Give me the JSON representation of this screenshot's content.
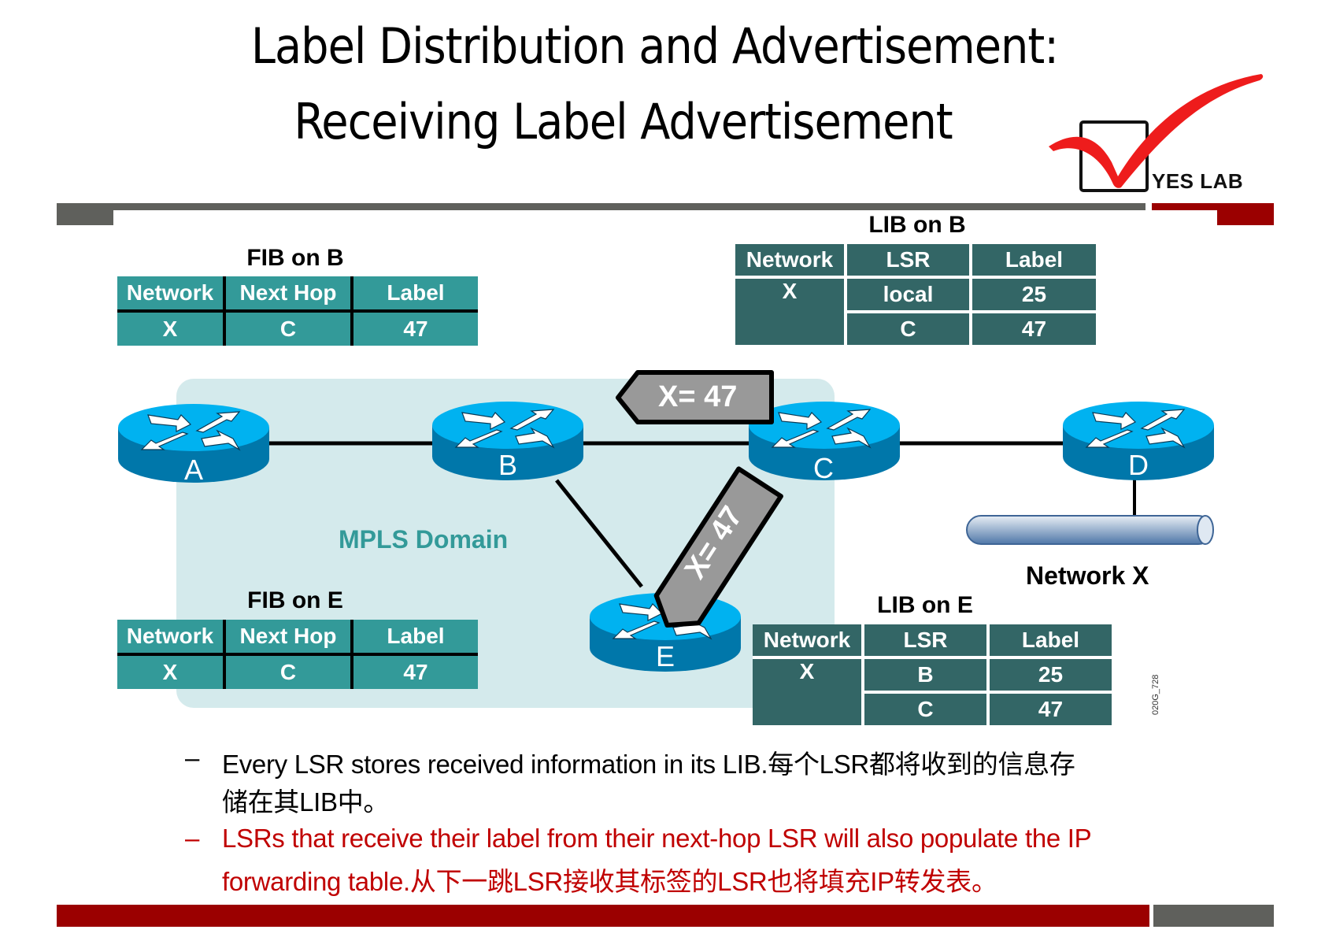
{
  "title": {
    "line1": "Label Distribution and Advertisement:",
    "line2": "Receiving Label Advertisement"
  },
  "logo": {
    "text": "YES LAB",
    "icon": "checkmark-box-icon",
    "check_color": "#ee1c1c"
  },
  "colors": {
    "bar_grey": "#5f605c",
    "bar_red": "#9b0000",
    "fib_teal": "#339a99",
    "lib_dark_teal": "#336666",
    "domain_bg": "#d4eaec",
    "router_blue": "#00b2f0",
    "router_side": "#0077aa",
    "label_tag_grey": "#999999",
    "highlight_red": "#c00000"
  },
  "fib_on_b": {
    "title": "FIB on B",
    "headers": [
      "Network",
      "Next Hop",
      "Label"
    ],
    "rows": [
      [
        "X",
        "C",
        "47"
      ]
    ]
  },
  "lib_on_b": {
    "title": "LIB on B",
    "headers": [
      "Network",
      "LSR",
      "Label"
    ],
    "network": "X",
    "rows": [
      {
        "lsr": "local",
        "label": "25"
      },
      {
        "lsr": "C",
        "label": "47"
      }
    ]
  },
  "fib_on_e": {
    "title": "FIB on E",
    "headers": [
      "Network",
      "Next Hop",
      "Label"
    ],
    "rows": [
      [
        "X",
        "C",
        "47"
      ]
    ]
  },
  "lib_on_e": {
    "title": "LIB on E",
    "headers": [
      "Network",
      "LSR",
      "Label"
    ],
    "network": "X",
    "rows": [
      {
        "lsr": "B",
        "label": "25"
      },
      {
        "lsr": "C",
        "label": "47"
      }
    ]
  },
  "diagram": {
    "domain_label": "MPLS Domain",
    "routers": [
      "A",
      "B",
      "C",
      "D",
      "E"
    ],
    "advert_to_b": "X= 47",
    "advert_to_e": "X= 47",
    "network_label": "Network X",
    "figure_id": "020G_728"
  },
  "bullets": [
    {
      "dash": "–",
      "line1": "Every LSR stores received information in its LIB.每个LSR都将收到的信息存",
      "line2": "储在其LIB中。",
      "color": "black"
    },
    {
      "dash": "–",
      "line1": "LSRs that receive their label from their next-hop LSR will also populate the IP",
      "line2": "forwarding table.从下一跳LSR接收其标签的LSR也将填充IP转发表。",
      "color": "red"
    }
  ]
}
